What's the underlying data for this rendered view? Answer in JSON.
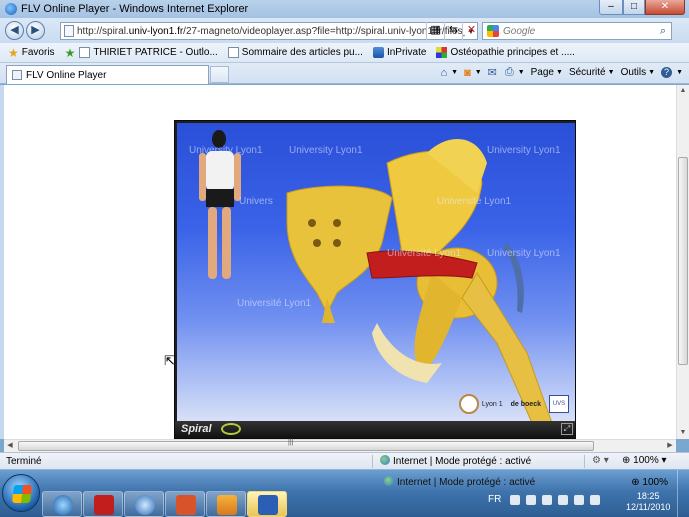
{
  "window": {
    "title": "FLV Online Player - Windows Internet Explorer",
    "controls": {
      "minimize": "–",
      "maximize": "□",
      "close": "✕"
    }
  },
  "addressbar": {
    "url_prefix": "http://spiral.",
    "url_host": "univ-lyon1.fr",
    "url_rest": "/27-magneto/videoplayer.asp?file=http://spiral.univ-lyon1.fr/files_m/",
    "search_placeholder": "Google"
  },
  "favorites": {
    "favoris_label": "Favoris",
    "items": [
      {
        "label": "THIRIET PATRICE - Outlo...",
        "icon": "page-icon"
      },
      {
        "label": "Sommaire des articles pu...",
        "icon": "page-icon"
      },
      {
        "label": "InPrivate",
        "icon": "inprivate-icon"
      },
      {
        "label": "Ostéopathie principes et .....",
        "icon": "osteo-icon"
      }
    ]
  },
  "tab": {
    "label": "FLV Online Player"
  },
  "commandbar": {
    "page": "Page",
    "security": "Sécurité",
    "tools": "Outils",
    "help": "?"
  },
  "player": {
    "watermarks": [
      "University Lyon1",
      "University Lyon1",
      "University Lyon1",
      "Univers",
      "Université Lyon1",
      "Université Lyon1",
      "Université Lyon1",
      "University Lyon1"
    ],
    "brand": "Spiral",
    "logo_lyon": "Lyon 1",
    "logo_deboeck": "de boeck",
    "logo_uvs": "UVS"
  },
  "statusbar": {
    "left_text": "Terminé",
    "zone_text": "Internet | Mode protégé : activé",
    "zoom": "100%"
  },
  "taskbar": {
    "apps": [
      "ie",
      "acrobat",
      "quicktime",
      "presentation",
      "media-player",
      "word"
    ],
    "ie_status": "Internet | Mode protégé : activé",
    "ie_zoom": "100%",
    "language": "FR",
    "time": "18:25",
    "date": "12/11/2010"
  },
  "colors": {
    "title_gradient": "#b9d1ea",
    "video_blue": "#2a4fd8",
    "bone_yellow": "#e8c23a",
    "muscle_red": "#c21e1e",
    "taskbar_blue": "#3f74ad"
  }
}
